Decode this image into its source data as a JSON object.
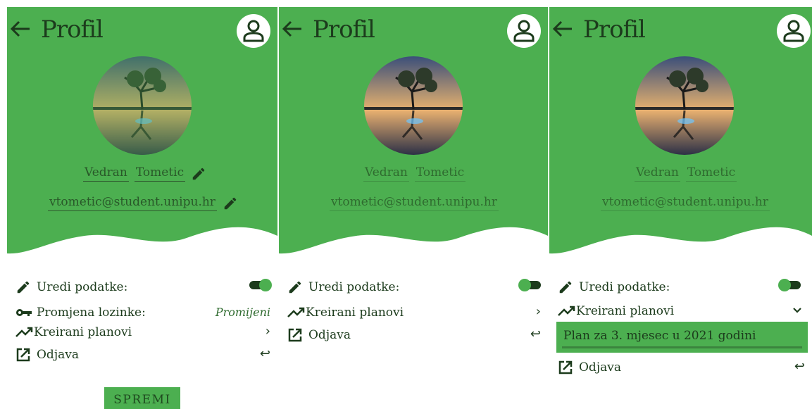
{
  "header": {
    "title": "Profil",
    "back_icon": "arrow-left-icon",
    "account_icon": "account-circle-icon"
  },
  "profile": {
    "first_name": "Vedran",
    "last_name": "Tometic",
    "email": "vtometic@student.unipu.hr"
  },
  "menu": {
    "edit_label": "Uredi podatke:",
    "password_label": "Promjena lozinke:",
    "password_action": "Promijeni",
    "plans_label": "Kreirani planovi",
    "logout_label": "Odjava"
  },
  "plans": [
    "Plan za 3. mjesec u 2021 godini"
  ],
  "save_button": "SPREMI",
  "icons": {
    "chevron_right": "›",
    "chevron_down": "⌄",
    "return": "↩"
  },
  "colors": {
    "primary_green": "#4caf50",
    "dark_green": "#1c3b1c",
    "background": "#ffffff"
  },
  "states": {
    "panel1_edit_toggle_on": true,
    "panel2_edit_toggle_on": false,
    "panel3_edit_toggle_on": false,
    "panel3_plans_expanded": true
  }
}
